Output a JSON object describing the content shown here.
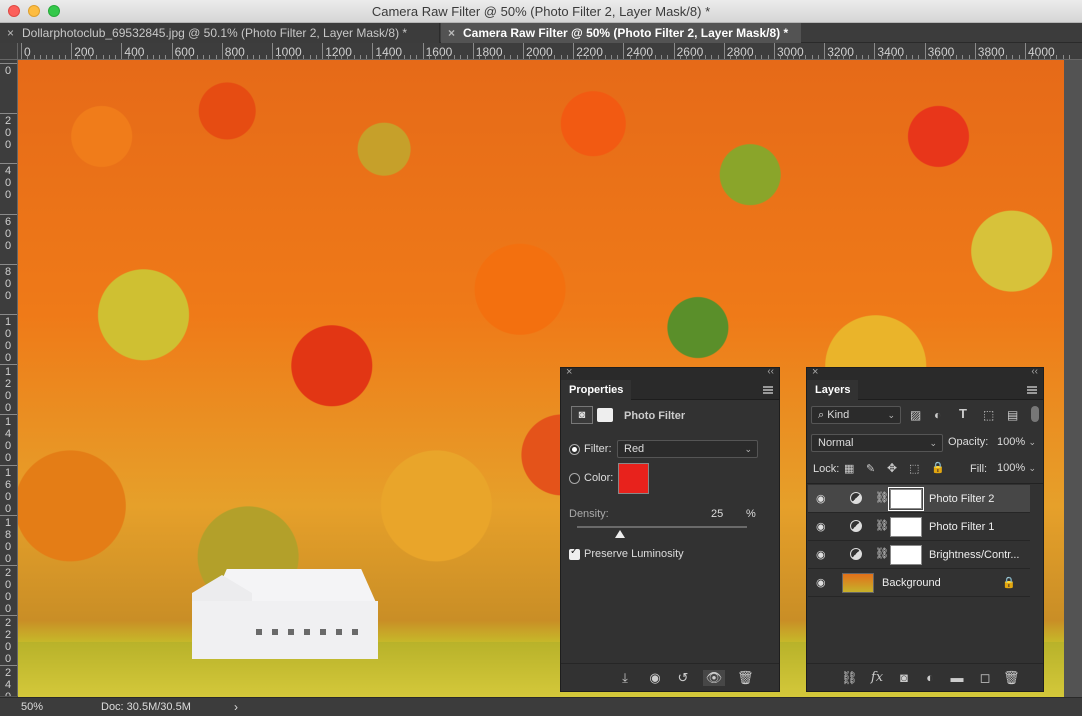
{
  "window": {
    "title": "Camera Raw Filter @ 50% (Photo Filter 2, Layer Mask/8) *"
  },
  "tabs": [
    {
      "label": "Dollarphotoclub_69532845.jpg @ 50.1% (Photo Filter 2, Layer Mask/8) *",
      "active": false
    },
    {
      "label": "Camera Raw Filter @ 50% (Photo Filter 2, Layer Mask/8) *",
      "active": true
    }
  ],
  "ruler": {
    "top_labels": [
      "0",
      "200",
      "400",
      "600",
      "800",
      "1000",
      "1200",
      "1400",
      "1600",
      "1800",
      "2000",
      "2200",
      "2400",
      "2600",
      "2800",
      "3000",
      "3200",
      "3400",
      "3600",
      "3800",
      "4000"
    ],
    "left_labels": [
      "0",
      "200",
      "400",
      "600",
      "800",
      "1000",
      "1200",
      "1400",
      "1600",
      "1800",
      "2000",
      "2200",
      "2400"
    ]
  },
  "status": {
    "zoom": "50%",
    "doc": "Doc: 30.5M/30.5M",
    "arrow": "›"
  },
  "properties": {
    "close": "×",
    "collapse": "‹‹",
    "tab": "Properties",
    "header_label": "Photo Filter",
    "filter_label": "Filter:",
    "filter_value": "Red",
    "color_label": "Color:",
    "color_swatch": "#e8221c",
    "density_label": "Density:",
    "density_value": "25",
    "density_unit": "%",
    "density_fraction": 0.25,
    "preserve_label": "Preserve Luminosity",
    "preserve_checked": true
  },
  "layers": {
    "close": "×",
    "collapse": "‹‹",
    "tab": "Layers",
    "kind_label": "Kind",
    "blend_mode": "Normal",
    "opacity_label": "Opacity:",
    "opacity_value": "100%",
    "lock_label": "Lock:",
    "fill_label": "Fill:",
    "fill_value": "100%",
    "rows": [
      {
        "name": "Photo Filter 2",
        "selected": true
      },
      {
        "name": "Photo Filter 1",
        "selected": false
      },
      {
        "name": "Brightness/Contr...",
        "selected": false
      },
      {
        "name": "Background",
        "selected": false
      }
    ]
  },
  "icons": {
    "eye": "eye-icon",
    "chain": "chain-link-icon",
    "lock": "lock-icon",
    "search": "search-icon",
    "trash": "trash-icon",
    "new_layer": "new-layer-icon",
    "folder": "folder-icon",
    "fx": "fx-icon",
    "link": "link-layers-icon",
    "mask": "add-mask-icon",
    "adjustment": "adjustment-layer-icon"
  },
  "glyphs": {
    "eye": "◉",
    "chain": "⛓",
    "lock": "🔒",
    "chevron": "⌄",
    "fx": "fx",
    "trash": "🗑",
    "folder": "▬",
    "new": "◻",
    "link": "⛓",
    "mask": "◙",
    "adj": "◐",
    "clip": "⤓",
    "visibility": "◉",
    "reset": "↺",
    "toggle": "👁",
    "kind_search": "⌕"
  }
}
